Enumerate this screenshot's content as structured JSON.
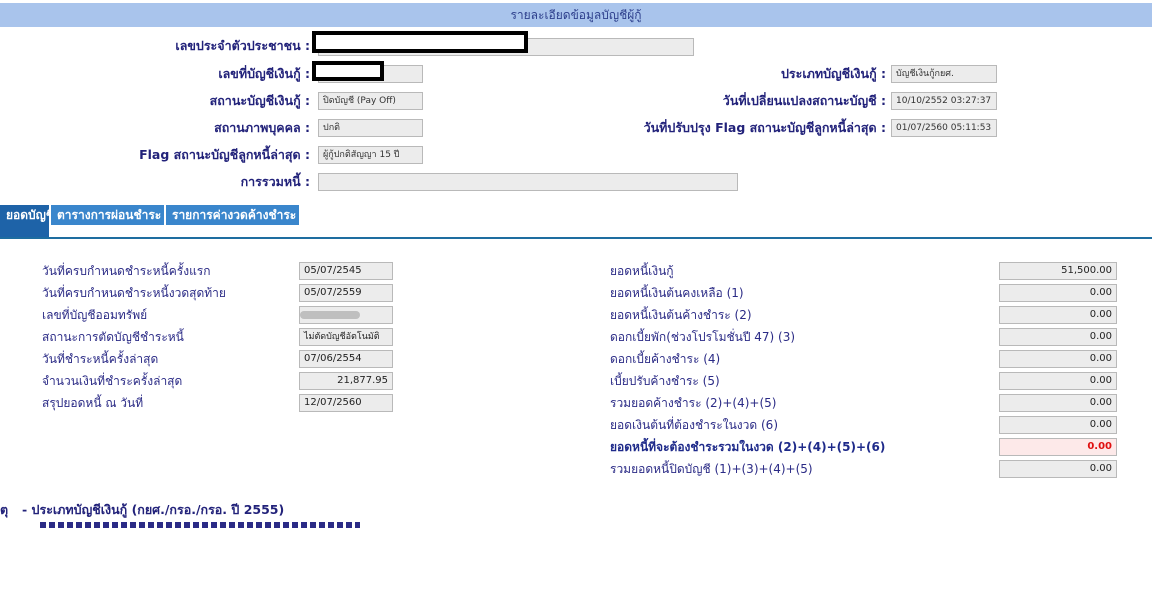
{
  "header": {
    "title": "รายละเอียดข้อมูลบัญชีผู้กู้"
  },
  "account": {
    "id_card_label": "เลขประจำตัวประชาชน :",
    "account_no_label": "เลขที่บัญชีเงินกู้ :",
    "status_label": "สถานะบัญชีเงินกู้ :",
    "status_value": "ปิดบัญชี (Pay Off)",
    "person_status_label": "สถานภาพบุคคล :",
    "person_status_value": "ปกติ",
    "flag_label": "Flag สถานะบัญชีลูกหนี้ล่าสุด :",
    "flag_value": "ผู้กู้ปกติสัญญา 15 ปี",
    "debt_merge_label": "การรวมหนี้ :",
    "debt_merge_value": "",
    "loan_type_label": "ประเภทบัญชีเงินกู้ :",
    "loan_type_value": "บัญชีเงินกู้กยศ.",
    "status_change_date_label": "วันที่เปลี่ยนแปลงสถานะบัญชี :",
    "status_change_date_value": "10/10/2552 03:27:37",
    "flag_update_date_label": "วันที่ปรับปรุง Flag สถานะบัญชีลูกหนี้ล่าสุด :",
    "flag_update_date_value": "01/07/2560 05:11:53"
  },
  "tabs": [
    {
      "label": "ยอดบัญชี"
    },
    {
      "label": "ตารางการผ่อนชำระ"
    },
    {
      "label": "รายการค่างวดค้างชำระ"
    }
  ],
  "left_details": [
    {
      "label": "วันที่ครบกำหนดชำระหนี้ครั้งแรก",
      "value": "05/07/2545"
    },
    {
      "label": "วันที่ครบกำหนดชำระหนี้งวดสุดท้าย",
      "value": "05/07/2559"
    },
    {
      "label": "เลขที่บัญชีออมทรัพย์",
      "value": ""
    },
    {
      "label": "สถานะการตัดบัญชีชำระหนี้",
      "value": "ไม่ตัดบัญชีอัตโนมัติ"
    },
    {
      "label": "วันที่ชำระหนี้ครั้งล่าสุด",
      "value": "07/06/2554"
    },
    {
      "label": "จำนวนเงินที่ชำระครั้งล่าสุด",
      "value": "21,877.95"
    },
    {
      "label": "สรุปยอดหนี้ ณ วันที่",
      "value": "12/07/2560"
    }
  ],
  "right_details": [
    {
      "label": "ยอดหนี้เงินกู้",
      "value": "51,500.00"
    },
    {
      "label": "ยอดหนี้เงินต้นคงเหลือ (1)",
      "value": "0.00"
    },
    {
      "label": "ยอดหนี้เงินต้นค้างชำระ (2)",
      "value": "0.00"
    },
    {
      "label": "ดอกเบี้ยพัก(ช่วงโปรโมชั่นปี 47) (3)",
      "value": "0.00"
    },
    {
      "label": "ดอกเบี้ยค้างชำระ (4)",
      "value": "0.00"
    },
    {
      "label": "เบี้ยปรับค้างชำระ (5)",
      "value": "0.00"
    },
    {
      "label": "รวมยอดค้างชำระ (2)+(4)+(5)",
      "value": "0.00"
    },
    {
      "label": "ยอดเงินต้นที่ต้องชำระในงวด (6)",
      "value": "0.00"
    },
    {
      "label": "ยอดหนี้ที่จะต้องชำระรวมในงวด   (2)+(4)+(5)+(6)",
      "value": "0.00"
    },
    {
      "label": "รวมยอดหนี้ปิดบัญชี (1)+(3)+(4)+(5)",
      "value": "0.00"
    }
  ],
  "notes": {
    "prefix": "ตุ",
    "line1": "-  ประเภทบัญชีเงินกู้ (กยศ./กรอ./กรอ. ปี 2555)"
  }
}
